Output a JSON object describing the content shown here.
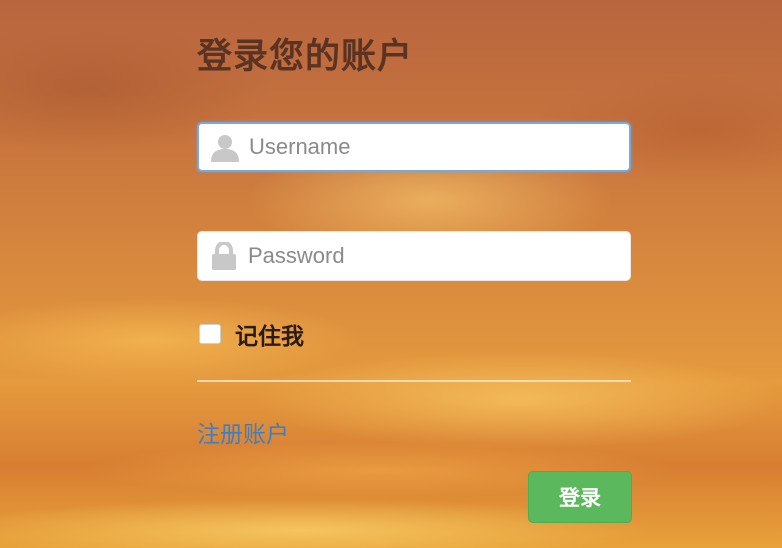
{
  "login_form": {
    "title": "登录您的账户",
    "username": {
      "placeholder": "Username",
      "value": "",
      "icon": "user-icon"
    },
    "password": {
      "placeholder": "Password",
      "value": "",
      "icon": "lock-icon"
    },
    "remember_me": {
      "label": "记住我",
      "checked": false
    },
    "register_link": "注册账户",
    "submit_label": "登录"
  },
  "colors": {
    "title": "#5a3322",
    "link": "#3d7fc4",
    "button": "#5cb85c",
    "focus_border": "#79a8dc",
    "icon": "#c8c8c8"
  }
}
